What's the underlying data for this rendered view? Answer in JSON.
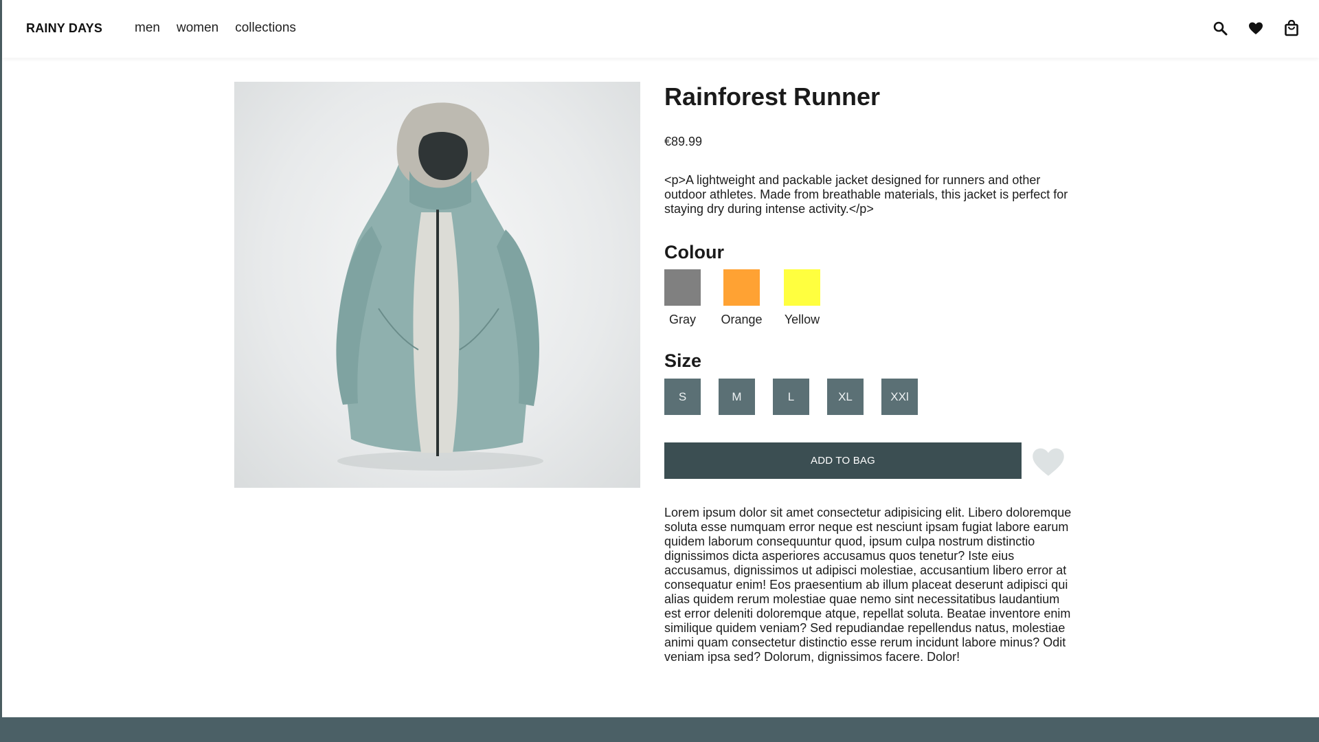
{
  "header": {
    "brand": "RAINY DAYS",
    "nav": [
      "men",
      "women",
      "collections"
    ],
    "icons": [
      "search-icon",
      "heart-icon",
      "shopping-bag-icon"
    ]
  },
  "product": {
    "title": "Rainforest Runner",
    "price": "€89.99",
    "description": "<p>A lightweight and packable jacket designed for runners and other outdoor athletes. Made from breathable materials, this jacket is perfect for staying dry during intense activity.</p>",
    "colour_label": "Colour",
    "colours": [
      {
        "name": "Gray",
        "hex": "#808080"
      },
      {
        "name": "Orange",
        "hex": "#ffa233"
      },
      {
        "name": "Yellow",
        "hex": "#ffff3f"
      }
    ],
    "size_label": "Size",
    "sizes": [
      "S",
      "M",
      "L",
      "XL",
      "XXl"
    ],
    "add_to_bag": "ADD TO BAG",
    "long_text": "Lorem ipsum dolor sit amet consectetur adipisicing elit. Libero doloremque soluta esse numquam error neque est nesciunt ipsam fugiat labore earum quidem laborum consequuntur quod, ipsum culpa nostrum distinctio dignissimos dicta asperiores accusamus quos tenetur? Iste eius accusamus, dignissimos ut adipisci molestiae, accusantium libero error at consequatur enim! Eos praesentium ab illum placeat deserunt adipisci qui alias quidem rerum molestiae quae nemo sint necessitatibus laudantium est error deleniti doloremque atque, repellat soluta. Beatae inventore enim similique quidem veniam? Sed repudiandae repellendus natus, molestiae animi quam consectetur distinctio esse rerum incidunt labore minus? Odit veniam ipsa sed? Dolorum, dignissimos facere. Dolor!"
  },
  "colors": {
    "button_dark": "#3b4e52",
    "size_button": "#5b7075",
    "footer": "#4b6066",
    "wishlist_heart": "#dde2e3"
  }
}
